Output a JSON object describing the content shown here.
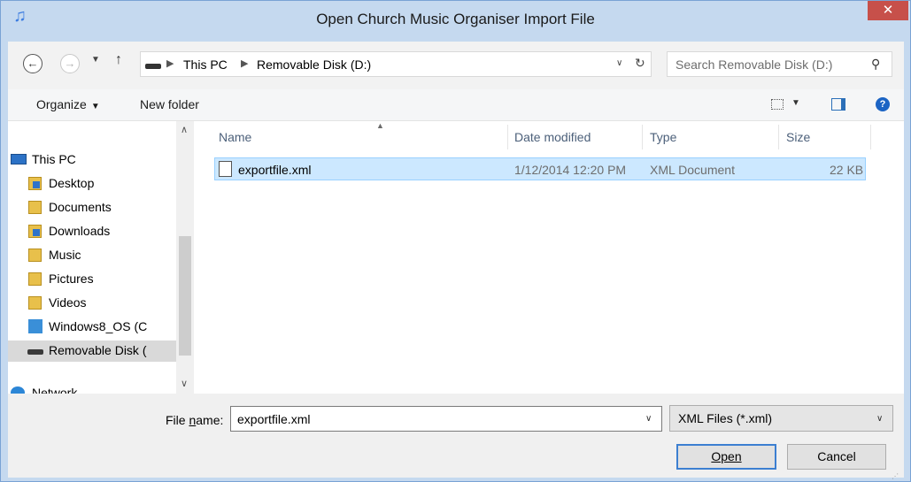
{
  "window": {
    "title": "Open Church Music Organiser Import File",
    "app_icon": "music-note-icon",
    "close_label": "✕"
  },
  "address": {
    "crumbs": [
      "This PC",
      "Removable Disk (D:)"
    ],
    "search_placeholder": "Search Removable Disk (D:)"
  },
  "toolbar": {
    "organize_label": "Organize",
    "new_folder_label": "New folder"
  },
  "navigation": {
    "items": [
      {
        "label": "This PC",
        "icon": "computer-icon"
      },
      {
        "label": "Desktop",
        "icon": "desktop-folder-icon"
      },
      {
        "label": "Documents",
        "icon": "documents-folder-icon"
      },
      {
        "label": "Downloads",
        "icon": "downloads-folder-icon"
      },
      {
        "label": "Music",
        "icon": "music-folder-icon"
      },
      {
        "label": "Pictures",
        "icon": "pictures-folder-icon"
      },
      {
        "label": "Videos",
        "icon": "videos-folder-icon"
      },
      {
        "label": "Windows8_OS (C",
        "icon": "os-drive-icon"
      },
      {
        "label": "Removable Disk (",
        "icon": "removable-disk-icon"
      },
      {
        "label": "Network",
        "icon": "network-icon"
      }
    ],
    "selected": "Removable Disk ("
  },
  "file_list": {
    "columns": [
      "Name",
      "Date modified",
      "Type",
      "Size"
    ],
    "rows": [
      {
        "name": "exportfile.xml",
        "date_modified": "1/12/2014 12:20 PM",
        "type": "XML Document",
        "size": "22 KB"
      }
    ]
  },
  "bottom": {
    "file_name_label": "File name:",
    "file_name_mnemonic": "n",
    "file_name_value": "exportfile.xml",
    "file_type": "XML Files (*.xml)",
    "open_label": "Open",
    "cancel_label": "Cancel"
  },
  "colors": {
    "titlebar": "#c5d9ef",
    "close": "#c7504a",
    "selection": "#cce8ff",
    "selection_border": "#99d1ff"
  }
}
